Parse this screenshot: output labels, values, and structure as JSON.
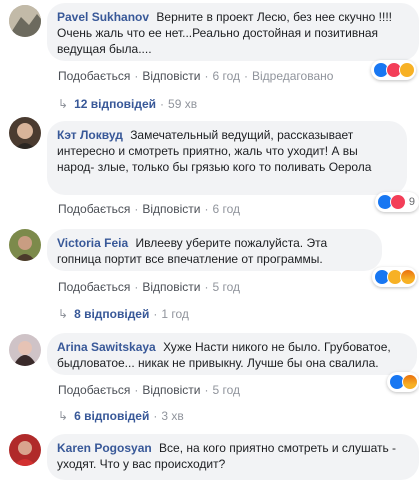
{
  "comments": [
    {
      "author": "Pavel Sukhanov",
      "text": "Верните в проект Лесю, без нее скучно !!!! Очень жаль что ее нет...Реально достойная и позитивная ведущая была....",
      "actions": {
        "like": "Подобається",
        "reply": "Відповісти",
        "time": "6 год",
        "edited": "Відредаговано"
      },
      "reactions": [
        "like-icon",
        "love-icon",
        "wow-icon"
      ],
      "reactions_count": "",
      "replies": {
        "label": "12 відповідей",
        "time": "59 хв"
      }
    },
    {
      "author": "Кэт Локвуд",
      "text": "Замечательный ведущий, рассказывает интересно и смотреть приятно, жаль что уходит! А вы народ- злые, только бы грязью кого то поливать Оерола",
      "actions": {
        "like": "Подобається",
        "reply": "Відповісти",
        "time": "6 год"
      },
      "reactions": [
        "like-icon",
        "love-icon"
      ],
      "reactions_count": "9",
      "replies": null
    },
    {
      "author": "Victoria Feia",
      "text": "Ивлееву уберите пожалуйста. Эта гопница портит все впечатление от программы.",
      "actions": {
        "like": "Подобається",
        "reply": "Відповісти",
        "time": "5 год"
      },
      "reactions": [
        "like-icon",
        "haha-icon",
        "angry-icon"
      ],
      "reactions_count": "",
      "replies": {
        "label": "8 відповідей",
        "time": "1 год"
      }
    },
    {
      "author": "Arina Sawitskaya",
      "text": "Хуже Насти никого не было. Грубоватое, быдловатое... никак не привыкну. Лучше бы она свалила.",
      "actions": {
        "like": "Подобається",
        "reply": "Відповісти",
        "time": "5 год"
      },
      "reactions": [
        "like-icon",
        "angry-icon"
      ],
      "reactions_count": "",
      "replies": {
        "label": "6 відповідей",
        "time": "3 хв"
      }
    },
    {
      "author": "Karen Pogosyan",
      "text": "Все, на кого приятно смотреть и слушать - уходят. Что у вас происходит?",
      "actions": null,
      "reactions": [],
      "reactions_count": "",
      "replies": null
    }
  ]
}
